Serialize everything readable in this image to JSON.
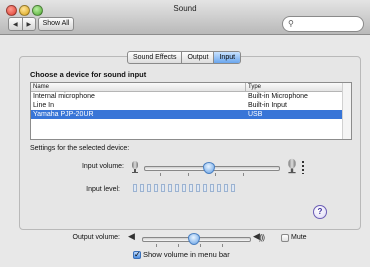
{
  "window": {
    "title": "Sound"
  },
  "toolbar": {
    "back_label": "◀",
    "forward_label": "▶",
    "show_all_label": "Show All",
    "search_placeholder": ""
  },
  "tabs": [
    {
      "label": "Sound Effects"
    },
    {
      "label": "Output"
    },
    {
      "label": "Input",
      "selected": true
    }
  ],
  "input": {
    "choose_label": "Choose a device for sound input",
    "table": {
      "headers": [
        "Name",
        "Type"
      ],
      "rows": [
        {
          "name": "Internal microphone",
          "type": "Built-in Microphone"
        },
        {
          "name": "Line In",
          "type": "Built-in Input"
        },
        {
          "name": "Yamaha PJP-20UR",
          "type": "USB",
          "selected": true
        }
      ]
    },
    "settings_label": "Settings for the selected device:",
    "input_volume_label": "Input volume:",
    "input_volume_value": 0.47,
    "input_level_label": "Input level:",
    "input_level_segments": 15
  },
  "output": {
    "volume_label": "Output volume:",
    "volume_value": 0.47,
    "mute_label": "Mute",
    "mute_checked": false,
    "show_volume_label": "Show volume in menu bar",
    "show_volume_checked": true
  },
  "icons": {
    "help": "help-icon",
    "search": "search-icon"
  },
  "colors": {
    "selection": "#3875d7",
    "tab_active": "#6aa6ee"
  }
}
